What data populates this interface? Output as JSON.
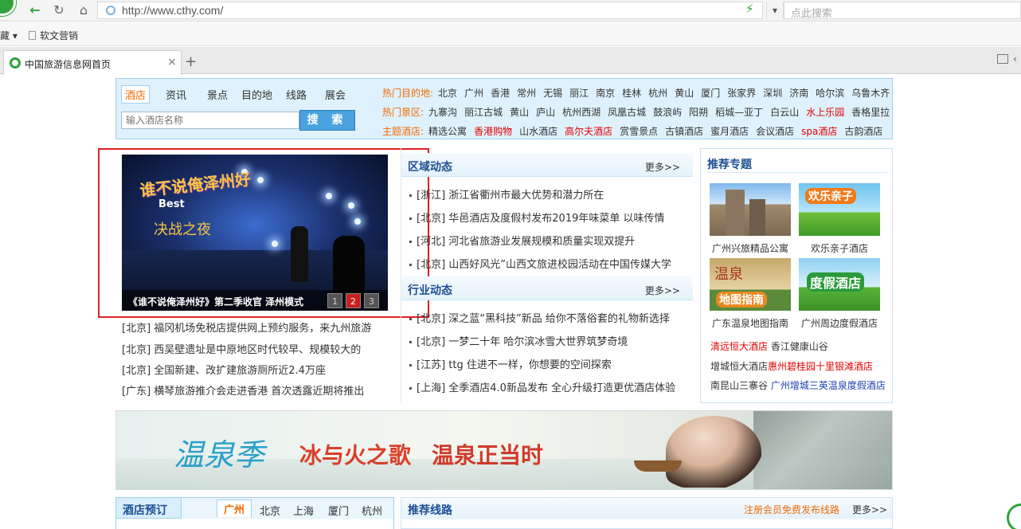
{
  "browser": {
    "url": "http://www.cthy.com/",
    "search_placeholder": "点此搜索",
    "fav_left": "藏",
    "fav_item": "软文营销",
    "tab_title": "中国旅游信息网首页",
    "tab_close": "×",
    "newtab": "+"
  },
  "search": {
    "tabs": [
      "酒店",
      "资讯",
      "景点",
      "目的地",
      "线路",
      "展会"
    ],
    "input_placeholder": "输入酒店名称",
    "button": "搜 索"
  },
  "hot": {
    "dest_label": "热门目的地:",
    "dest": [
      "北京",
      "广州",
      "香港",
      "常州",
      "无锡",
      "丽江",
      "南京",
      "桂林",
      "杭州",
      "黄山",
      "厦门",
      "张家界",
      "深圳",
      "济南",
      "哈尔滨",
      "乌鲁木齐"
    ],
    "scenic_label": "热门景区:",
    "scenic": [
      "九寨沟",
      "丽江古城",
      "黄山",
      "庐山",
      "杭州西湖",
      "凤凰古城",
      "鼓浪屿",
      "阳朔",
      "稻城—亚丁",
      "白云山",
      "水上乐园",
      "香格里拉"
    ],
    "theme_label": "主题酒店:",
    "theme": [
      "精选公寓",
      "香港购物",
      "山水酒店",
      "高尔夫酒店",
      "赏雪景点",
      "古镇酒店",
      "蜜月酒店",
      "会议酒店",
      "spa酒店",
      "古韵酒店"
    ]
  },
  "slide": {
    "logo_text": "谁不说俺泽州好",
    "logo_sub": "Best",
    "logo_night": "决战之夜",
    "caption": "《谁不说俺泽州好》第二季收官 泽州模式",
    "pages": [
      "1",
      "2",
      "3"
    ],
    "active_page": 2
  },
  "left_news": [
    "[北京] 福冈机场免税店提供网上预约服务，来九州旅游",
    "[北京] 西吴壁遗址是中原地区时代较早、规模较大的",
    "[北京] 全国新建、改扩建旅游厕所近2.4万座",
    "[广东] 横琴旅游推介会走进香港 首次透露近期将推出"
  ],
  "region": {
    "title": "区域动态",
    "more": "更多>>",
    "items": [
      "[浙江] 浙江省衢州市最大优势和潜力所在",
      "[北京] 华邑酒店及度假村发布2019年味菜单 以味传情",
      "[河北] 河北省旅游业发展规模和质量实现双提升",
      "[北京] 山西好风光”山西文旅进校园活动在中国传媒大学"
    ]
  },
  "industry": {
    "title": "行业动态",
    "more": "更多>>",
    "items": [
      "[北京] 深之蓝“黑科技”新品 给你不落俗套的礼物新选择",
      "[北京] 一梦二十年 哈尔滨冰雪大世界筑梦奇境",
      "[江苏] ttg 住进不一样，你想要的空间探索",
      "[上海] 全季酒店4.0新品发布 全心升级打造更优酒店体验"
    ]
  },
  "recommend": {
    "title": "推荐专题",
    "thumbs": [
      {
        "caption": "广州兴旅精品公寓",
        "overlay": ""
      },
      {
        "caption": "欢乐亲子酒店",
        "overlay": "欢乐亲子"
      },
      {
        "caption": "广东温泉地图指南",
        "overlay": "温泉",
        "overlay2": "地图指南"
      },
      {
        "caption": "广州周边度假酒店",
        "overlay": "度假酒店"
      }
    ],
    "links": [
      [
        {
          "t": "清远恒大酒店",
          "c": "r"
        },
        {
          "t": "香江健康山谷",
          "c": "n"
        }
      ],
      [
        {
          "t": "增城恒大酒店",
          "c": "n"
        },
        {
          "t": "惠州碧桂园十里银滩酒店",
          "c": "r"
        }
      ],
      [
        {
          "t": "南昆山三寨谷",
          "c": "n"
        },
        {
          "t": "广州增城三英温泉度假酒店",
          "c": "b"
        }
      ]
    ]
  },
  "banner": {
    "calligraphy": "温泉季",
    "line1": "冰与火之歌",
    "line2": "温泉正当时"
  },
  "hotel_booking": {
    "title": "酒店预订",
    "cities": [
      "广州",
      "北京",
      "上海",
      "厦门",
      "杭州"
    ]
  },
  "routes": {
    "title": "推荐线路",
    "register": "注册会员免费发布线路",
    "more": "更多>>"
  }
}
